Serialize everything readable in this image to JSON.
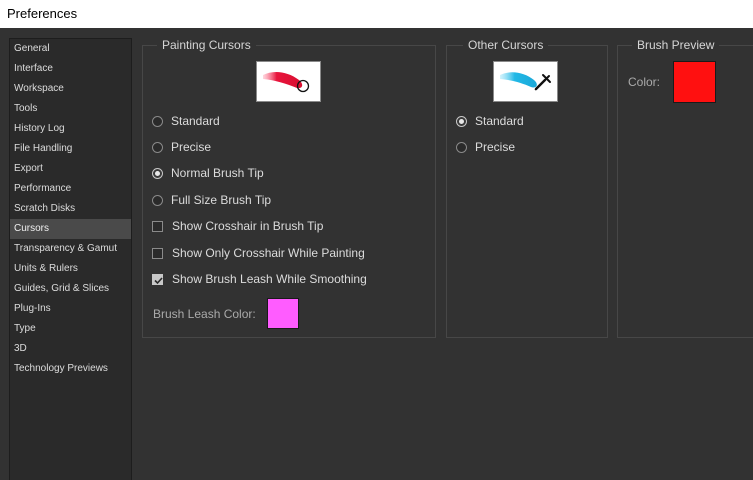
{
  "window": {
    "title": "Preferences"
  },
  "sidebar": {
    "items": [
      {
        "label": "General"
      },
      {
        "label": "Interface"
      },
      {
        "label": "Workspace"
      },
      {
        "label": "Tools"
      },
      {
        "label": "History Log"
      },
      {
        "label": "File Handling"
      },
      {
        "label": "Export"
      },
      {
        "label": "Performance"
      },
      {
        "label": "Scratch Disks"
      },
      {
        "label": "Cursors"
      },
      {
        "label": "Transparency & Gamut"
      },
      {
        "label": "Units & Rulers"
      },
      {
        "label": "Guides, Grid & Slices"
      },
      {
        "label": "Plug-Ins"
      },
      {
        "label": "Type"
      },
      {
        "label": "3D"
      },
      {
        "label": "Technology Previews"
      }
    ],
    "selected": "Cursors"
  },
  "painting_cursors": {
    "title": "Painting Cursors",
    "preview_icon": "brush-stroke-circle-cursor-icon",
    "options": {
      "standard": "Standard",
      "precise": "Precise",
      "normal_tip": "Normal Brush Tip",
      "full_tip": "Full Size Brush Tip"
    },
    "selected_option": "Normal Brush Tip",
    "checkboxes": {
      "crosshair": {
        "label": "Show Crosshair in Brush Tip",
        "checked": false
      },
      "only_crosshair": {
        "label": "Show Only Crosshair While Painting",
        "checked": false
      },
      "leash": {
        "label": "Show Brush Leash While Smoothing",
        "checked": true
      }
    },
    "leash_color_label": "Brush Leash Color:",
    "leash_color": "#ff5cff"
  },
  "other_cursors": {
    "title": "Other Cursors",
    "preview_icon": "eyedropper-cursor-icon",
    "options": {
      "standard": "Standard",
      "precise": "Precise"
    },
    "selected_option": "Standard"
  },
  "brush_preview": {
    "title": "Brush Preview",
    "color_label": "Color:",
    "color": "#ff1010"
  },
  "colors": {
    "painting_stroke": "#e8143c",
    "other_stroke": "#22b8e6"
  }
}
